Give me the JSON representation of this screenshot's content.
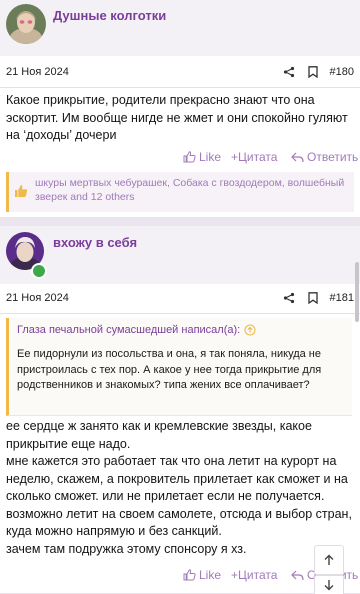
{
  "post1": {
    "author": "Душные колготки",
    "date": "21 Ноя 2024",
    "number": "#180",
    "text": "Какое прикрытие, родители прекрасно знают что она эскортит. Им вообще нигде не жмет и они спокойно гуляют на ‘доходы’ дочери",
    "reactions": "шкуры мертвых чебурашек, Собака с гвоздодером, волшебный зверек and 12 others"
  },
  "post2": {
    "author": "вхожу в себя",
    "date": "21 Ноя 2024",
    "number": "#181",
    "quote_author": "Глаза печальной сумасшедшей написал(а):",
    "quote_text": "Ее пидорнули из посольства и она, я так поняла, никуда не пристроилась с тех пор. А какое у нее тогда прикрытие для родственников и знакомых? типа жених все оплачивает?",
    "text": [
      "ее сердце ж занято как и кремлевские звезды, какое прикрытие еще надо.",
      "мне кажется это работает так что она летит на курорт на неделю, скажем, а покровитель прилетает как сможет и на сколько сможет. или не прилетает если не получается. возможно летит на своем самолете, отсюда и выбор стран, куда можно напрямую и без санкций.",
      "зачем там подружка этому спонсору я хз."
    ]
  },
  "actions": {
    "like": "Like",
    "quote": "+Цитата",
    "reply": "Ответить"
  },
  "colors": {
    "accent": "#7a3e9a",
    "action": "#a27ab8",
    "reaction_bar": "#f0b94a",
    "online": "#3fa84a"
  },
  "icons": [
    "share-icon",
    "bookmark-icon",
    "like-icon",
    "reply-icon",
    "quote-arrow-up-icon",
    "reaction-like-icon",
    "scroll-up-icon",
    "scroll-down-icon",
    "online-icon"
  ]
}
